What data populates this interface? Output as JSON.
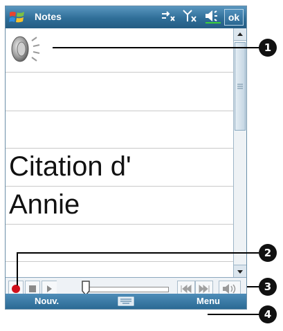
{
  "app": {
    "title": "Notes",
    "ok_label": "ok"
  },
  "note": {
    "line1": "Citation d'",
    "line2": "Annie"
  },
  "menubar": {
    "left_label": "Nouv.",
    "right_label": "Menu"
  },
  "callouts": [
    "1",
    "2",
    "3",
    "4"
  ],
  "colors": {
    "titlebar": "#2f6e98",
    "record": "#d0101b",
    "menubar": "#2b6a94"
  },
  "icons": {
    "start": "windows-flag-icon",
    "sync": "sync-icon",
    "signal": "signal-icon",
    "volume": "volume-icon",
    "voice_note": "speaker-icon",
    "keyboard": "keyboard-icon"
  }
}
